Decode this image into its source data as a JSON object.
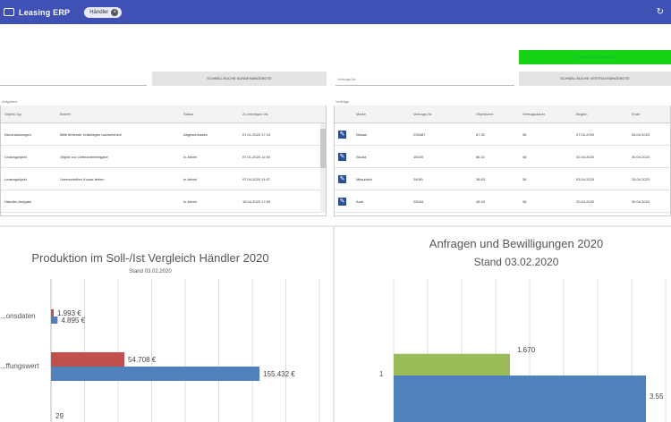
{
  "header": {
    "app_title": "Leasing ERP",
    "user_chip": "Händler",
    "refresh_icon": "refresh-icon"
  },
  "actions": {
    "green_button": "SCHNELLSUCHE PLUS",
    "left_search_button": "SCHNELLSUCHE KUNDENANGEBOTE",
    "right_search_button": "SCHNELLSUCHE VERTRAGSANGEBOTE",
    "contract_field_label": "Vertrags-Nr."
  },
  "tasks_table": {
    "label": "Aufgaben",
    "columns": [
      "Objekt-Typ",
      "Betreff",
      "Status",
      "Zu erledigen bis"
    ],
    "rows": [
      [
        "Neuzulassungen",
        "Bitte fehlende Unterlagen nachreichen!",
        "Abgeschlossen",
        "07.01.2020 17:13"
      ],
      [
        "Leasingobjekt",
        "Objekt zur Lieferantenfreigabe",
        "In Arbeit",
        "07.01.2020 11:45"
      ],
      [
        "Leasingobjekt",
        "Unterschriften Kunde fehlen",
        "In Arbeit",
        "07.04.2020 14:07"
      ],
      [
        "Händler-Aufgabe",
        "",
        "In Arbeit",
        "15.04.2020 17:09"
      ]
    ]
  },
  "contracts_table": {
    "label": "Verträge",
    "columns": [
      "",
      "Marke",
      "Vertrags-Nr.",
      "Objektwert",
      "Vertragsdauer",
      "Beginn",
      "Ende"
    ],
    "rows": [
      [
        "Nissan",
        "225487",
        "57.32",
        "36",
        "27.03.2020",
        "26.03.2023"
      ],
      [
        "Skoda",
        "15020",
        "86.31",
        "48",
        "02.04.2020",
        "30.04.2024"
      ],
      [
        "Mitsubishi",
        "24091",
        "38.63",
        "36",
        "03.04.2020",
        "26.04.2023"
      ],
      [
        "Audi",
        "25034",
        "45.20",
        "36",
        "20.04.2020",
        "30.04.2023"
      ]
    ]
  },
  "chart_data": [
    {
      "type": "bar",
      "orientation": "horizontal",
      "title": "Produktion im Soll-/Ist Vergleich Händler 2020",
      "subtitle": "Stand 03.02.2020",
      "categories": [
        "...onsdaten",
        "...ffungswert",
        ""
      ],
      "series": [
        {
          "color": "#c0504d",
          "values": [
            1993,
            54708,
            null
          ],
          "labels": [
            "1.993 €",
            "54.708 €",
            ""
          ]
        },
        {
          "color": "#4f81bd",
          "values": [
            4895,
            155432,
            null
          ],
          "labels": [
            "4.895 €",
            "155.432 €",
            ""
          ]
        }
      ],
      "xlim": [
        0,
        200000
      ],
      "partial_label": "29",
      "grid": true
    },
    {
      "type": "bar",
      "title": "Anfragen und Bewilligungen 2020",
      "subtitle": "Stand 03.02.2020",
      "categories": [
        "1"
      ],
      "series": [
        {
          "color": "#9bbb59",
          "values": [
            1670
          ],
          "labels": [
            "1.670"
          ]
        },
        {
          "color": "#4f81bd",
          "values": [
            3550
          ],
          "labels": [
            "3.55"
          ]
        }
      ],
      "grid": true
    }
  ],
  "colors": {
    "topbar": "#3f51b5",
    "accent_green": "#17d217",
    "edit_blue": "#2b4e94"
  }
}
